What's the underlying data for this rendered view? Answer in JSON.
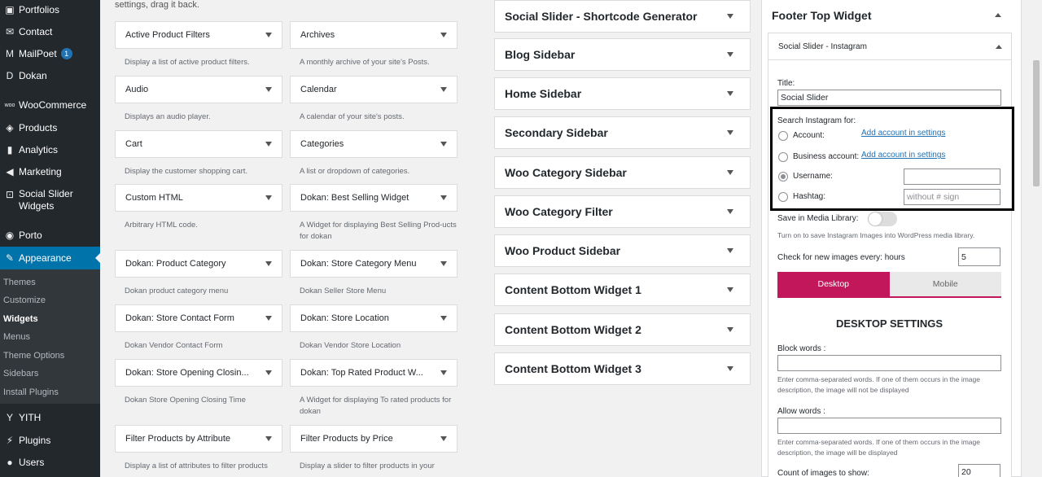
{
  "admin_menu": {
    "items": [
      {
        "label": "Portfolios",
        "icon": "portfolio-icon"
      },
      {
        "label": "Contact",
        "icon": "envelope-icon"
      },
      {
        "label": "MailPoet",
        "icon": "mailpoet-icon",
        "badge": "1"
      },
      {
        "label": "Dokan",
        "icon": "dokan-icon"
      },
      {
        "label": "WooCommerce",
        "icon": "woo-icon"
      },
      {
        "label": "Products",
        "icon": "box-icon"
      },
      {
        "label": "Analytics",
        "icon": "bar-chart-icon"
      },
      {
        "label": "Marketing",
        "icon": "megaphone-icon"
      },
      {
        "label": "Social Slider",
        "label2": "Widgets",
        "icon": "social-slider-icon"
      },
      {
        "label": "Porto",
        "icon": "porto-icon"
      },
      {
        "label": "Appearance",
        "icon": "brush-icon"
      },
      {
        "label": "YITH",
        "icon": "yith-icon"
      },
      {
        "label": "Plugins",
        "icon": "plug-icon"
      },
      {
        "label": "Users",
        "icon": "user-icon"
      }
    ],
    "appearance_submenu": [
      "Themes",
      "Customize",
      "Widgets",
      "Menus",
      "Theme Options",
      "Sidebars",
      "Install Plugins"
    ],
    "accent": "#0073aa"
  },
  "available": {
    "hint": "settings, drag it back.",
    "widgets": [
      {
        "name": "Active Product Filters",
        "desc": "Display a list of active product filters."
      },
      {
        "name": "Archives",
        "desc": "A monthly archive of your site's Posts."
      },
      {
        "name": "Audio",
        "desc": "Displays an audio player."
      },
      {
        "name": "Calendar",
        "desc": "A calendar of your site's posts."
      },
      {
        "name": "Cart",
        "desc": "Display the customer shopping cart."
      },
      {
        "name": "Categories",
        "desc": "A list or dropdown of categories."
      },
      {
        "name": "Custom HTML",
        "desc": "Arbitrary HTML code."
      },
      {
        "name": "Dokan: Best Selling Widget",
        "desc": "A Widget for displaying Best Selling Prod-ucts for dokan"
      },
      {
        "name": "Dokan: Product Category",
        "desc": "Dokan product category menu"
      },
      {
        "name": "Dokan: Store Category Menu",
        "desc": "Dokan Seller Store Menu"
      },
      {
        "name": "Dokan: Store Contact Form",
        "desc": "Dokan Vendor Contact Form"
      },
      {
        "name": "Dokan: Store Location",
        "desc": "Dokan Vendor Store Location"
      },
      {
        "name": "Dokan: Store Opening Closin...",
        "desc": "Dokan Store Opening Closing Time"
      },
      {
        "name": "Dokan: Top Rated Product W...",
        "desc": "A Widget for displaying To rated products for dokan"
      },
      {
        "name": "Filter Products by Attribute",
        "desc": "Display a list of attributes to filter products"
      },
      {
        "name": "Filter Products by Price",
        "desc": "Display a slider to filter products in your"
      }
    ]
  },
  "areas": [
    "Social Slider - Shortcode Generator",
    "Blog Sidebar",
    "Home Sidebar",
    "Secondary Sidebar",
    "Woo Category Sidebar",
    "Woo Category Filter",
    "Woo Product Sidebar",
    "Content Bottom Widget 1",
    "Content Bottom Widget 2",
    "Content Bottom Widget 3"
  ],
  "footer": {
    "title": "Footer Top Widget",
    "widget_title": "Social Slider - Instagram",
    "title_label": "Title:",
    "title_value": "Social Slider",
    "search_label": "Search Instagram for:",
    "account_label": "Account:",
    "add_account_link": "Add account in settings",
    "business_label": "Business account:",
    "add_business_link": "Add account in settings",
    "username_label": "Username:",
    "username_value": "",
    "hashtag_label": "Hashtag:",
    "hashtag_placeholder": "without # sign",
    "media_label": "Save in Media Library:",
    "media_note": "Turn on to save Instagram Images into WordPress media library.",
    "check_label": "Check for new images every:",
    "check_unit": "hours",
    "check_value": "5",
    "tab_desktop": "Desktop",
    "tab_mobile": "Mobile",
    "desktop_heading": "DESKTOP SETTINGS",
    "block_label": "Block words :",
    "block_note": "Enter comma-separated words. If one of them occurs in the image description, the image will not be displayed",
    "allow_label": "Allow words :",
    "allow_note": "Enter comma-separated words. If one of them occurs in the image description, the image will be displayed",
    "count_label": "Count of images to show:",
    "count_value": "20",
    "accent": "#c2185b"
  }
}
